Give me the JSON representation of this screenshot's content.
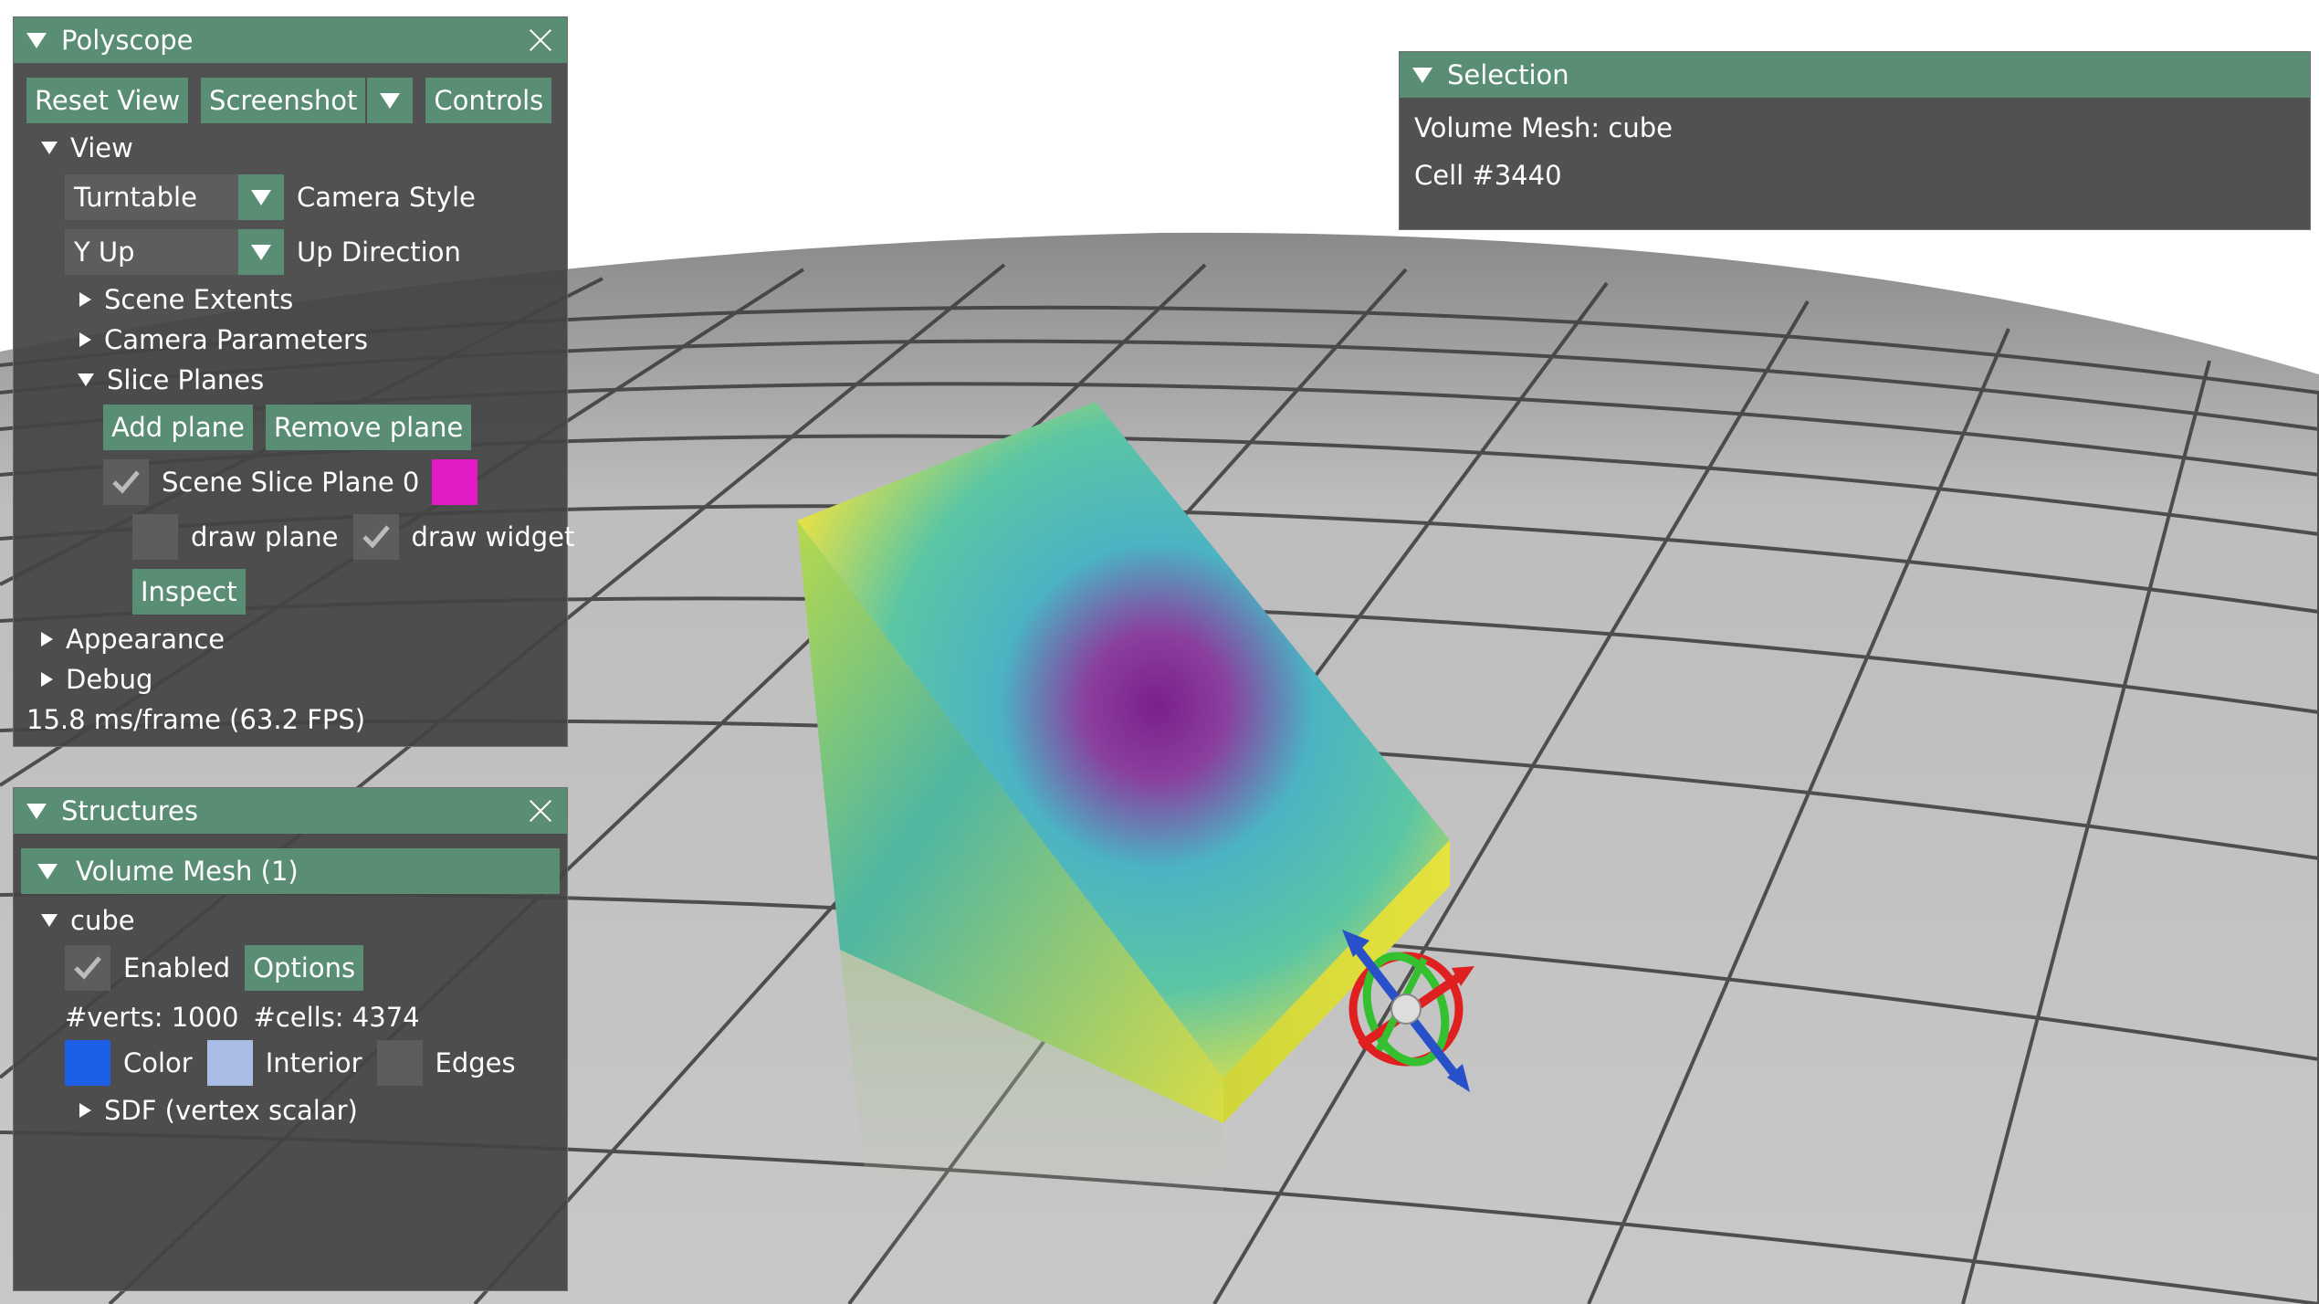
{
  "polyscope": {
    "title": "Polyscope",
    "buttons": {
      "reset_view": "Reset View",
      "screenshot": "Screenshot",
      "controls": "Controls"
    },
    "view": {
      "label": "View",
      "camera_style": {
        "value": "Turntable",
        "label": "Camera Style"
      },
      "up_direction": {
        "value": "Y Up",
        "label": "Up Direction"
      },
      "scene_extents": "Scene Extents",
      "camera_parameters": "Camera Parameters",
      "slice_planes": {
        "label": "Slice Planes",
        "add_plane": "Add plane",
        "remove_plane": "Remove plane",
        "plane_name": "Scene Slice Plane 0",
        "plane_enabled": true,
        "plane_color": "#e21bc7",
        "draw_plane": {
          "label": "draw plane",
          "checked": false
        },
        "draw_widget": {
          "label": "draw widget",
          "checked": true
        },
        "inspect": "Inspect"
      }
    },
    "appearance": "Appearance",
    "debug": "Debug",
    "frame_time": "15.8 ms/frame (63.2 FPS)"
  },
  "structures": {
    "title": "Structures",
    "group_header": "Volume Mesh (1)",
    "item": {
      "name": "cube",
      "enabled": {
        "label": "Enabled",
        "checked": true
      },
      "options": "Options",
      "verts": "#verts: 1000",
      "cells": "#cells: 4374",
      "color": {
        "label": "Color",
        "swatch": "#1d5fe6"
      },
      "interior": {
        "label": "Interior",
        "swatch": "#a9bde6"
      },
      "edges": {
        "label": "Edges",
        "swatch": "#5d5d5d"
      },
      "quantity": "SDF (vertex scalar)"
    }
  },
  "selection": {
    "title": "Selection",
    "line1": "Volume Mesh: cube",
    "line2": "Cell #3440"
  },
  "colors": {
    "accent": "#5a8e74",
    "panel_bg": "#444444",
    "colormap": [
      "#440154",
      "#31688e",
      "#35b779",
      "#fde725"
    ]
  }
}
